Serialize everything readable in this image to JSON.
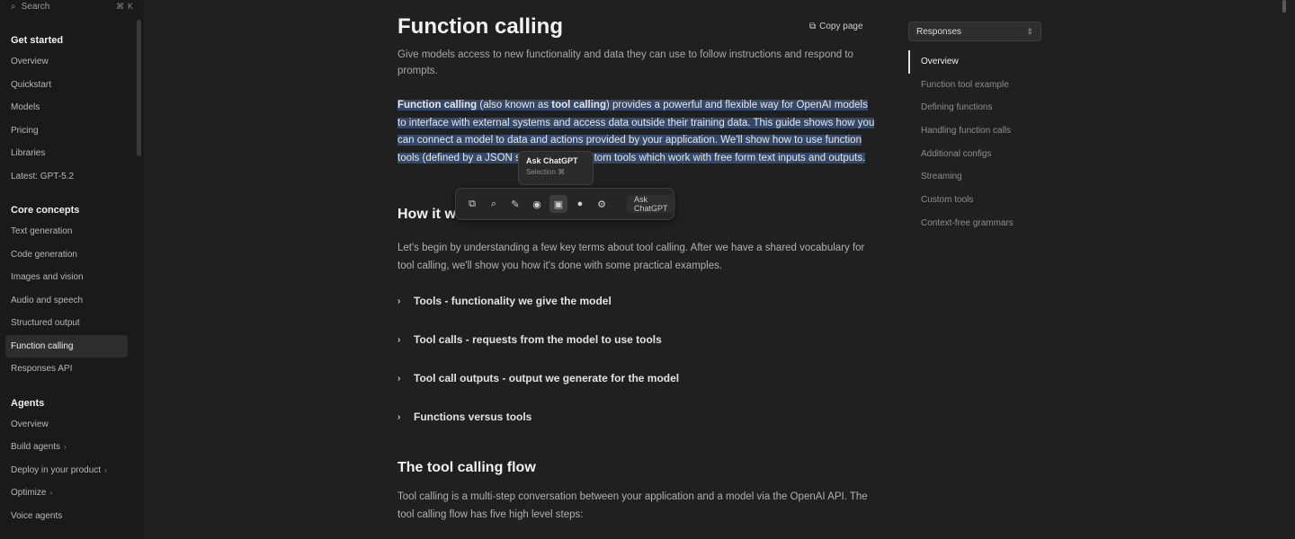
{
  "sidebar": {
    "search_label": "Search",
    "search_shortcut_1": "⌘",
    "search_shortcut_2": "K",
    "sections": [
      {
        "title": "Get started",
        "items": [
          {
            "label": "Overview"
          },
          {
            "label": "Quickstart"
          },
          {
            "label": "Models"
          },
          {
            "label": "Pricing"
          },
          {
            "label": "Libraries"
          },
          {
            "label": "Latest: GPT-5.2"
          }
        ]
      },
      {
        "title": "Core concepts",
        "items": [
          {
            "label": "Text generation"
          },
          {
            "label": "Code generation"
          },
          {
            "label": "Images and vision"
          },
          {
            "label": "Audio and speech"
          },
          {
            "label": "Structured output"
          },
          {
            "label": "Function calling",
            "active": true
          },
          {
            "label": "Responses API"
          }
        ]
      },
      {
        "title": "Agents",
        "items": [
          {
            "label": "Overview"
          },
          {
            "label": "Build agents",
            "chevron": "›"
          },
          {
            "label": "Deploy in your product",
            "chevron": "›"
          },
          {
            "label": "Optimize",
            "chevron": "›"
          },
          {
            "label": "Voice agents"
          }
        ]
      }
    ]
  },
  "page": {
    "title": "Function calling",
    "copy_label": "Copy page",
    "intro": "Give models access to new functionality and data they can use to follow instructions and respond to prompts.",
    "highlight_bold_1": "Function calling",
    "highlight_mid_1": " (also known as ",
    "highlight_bold_2": "tool calling",
    "highlight_rest": ") provides a powerful and flexible way for OpenAI models to interface with external systems and access data outside their training data. This guide shows how you can connect a model to data and actions provided by your application. We'll show how to use function tools (defined by a JSON schema) and custom tools which work with free form text inputs and outputs.",
    "h2_how": "How it works",
    "how_para": "Let's begin by understanding a few key terms about tool calling. After we have a shared vocabulary for tool calling, we'll show you how it's done with some practical examples.",
    "bullets": [
      {
        "label": "Tools - functionality we give the model"
      },
      {
        "label": "Tool calls - requests from the model to use tools"
      },
      {
        "label": "Tool call outputs - output we generate for the model"
      },
      {
        "label": "Functions versus tools"
      }
    ],
    "h2_flow": "The tool calling flow",
    "flow_para": "Tool calling is a multi-step conversation between your application and a model via the OpenAI API. The tool calling flow has five high level steps:"
  },
  "toolbar": {
    "buttons": [
      {
        "icon": "copy-icon",
        "glyph": "⧉"
      },
      {
        "icon": "search-icon",
        "glyph": "⌕"
      },
      {
        "icon": "pencil-icon",
        "glyph": "✎"
      },
      {
        "icon": "eye-icon",
        "glyph": "◉"
      },
      {
        "icon": "highlight-icon",
        "glyph": "▣"
      },
      {
        "icon": "bookmark-icon",
        "glyph": "●"
      },
      {
        "icon": "settings-icon",
        "glyph": "⚙"
      }
    ],
    "ask_label": "Ask ChatGPT"
  },
  "tooltip": {
    "title": "Ask ChatGPT",
    "subtitle": "Selection ⌘"
  },
  "toc": {
    "select_value": "Responses",
    "items": [
      {
        "label": "Overview",
        "active": true
      },
      {
        "label": "Function tool example"
      },
      {
        "label": "Defining functions"
      },
      {
        "label": "Handling function calls"
      },
      {
        "label": "Additional configs"
      },
      {
        "label": "Streaming"
      },
      {
        "label": "Custom tools"
      },
      {
        "label": "Context-free grammars"
      }
    ]
  },
  "colors": {
    "background": "#202020",
    "sidebar": "#1a1a1a",
    "selection": "#34496a"
  }
}
